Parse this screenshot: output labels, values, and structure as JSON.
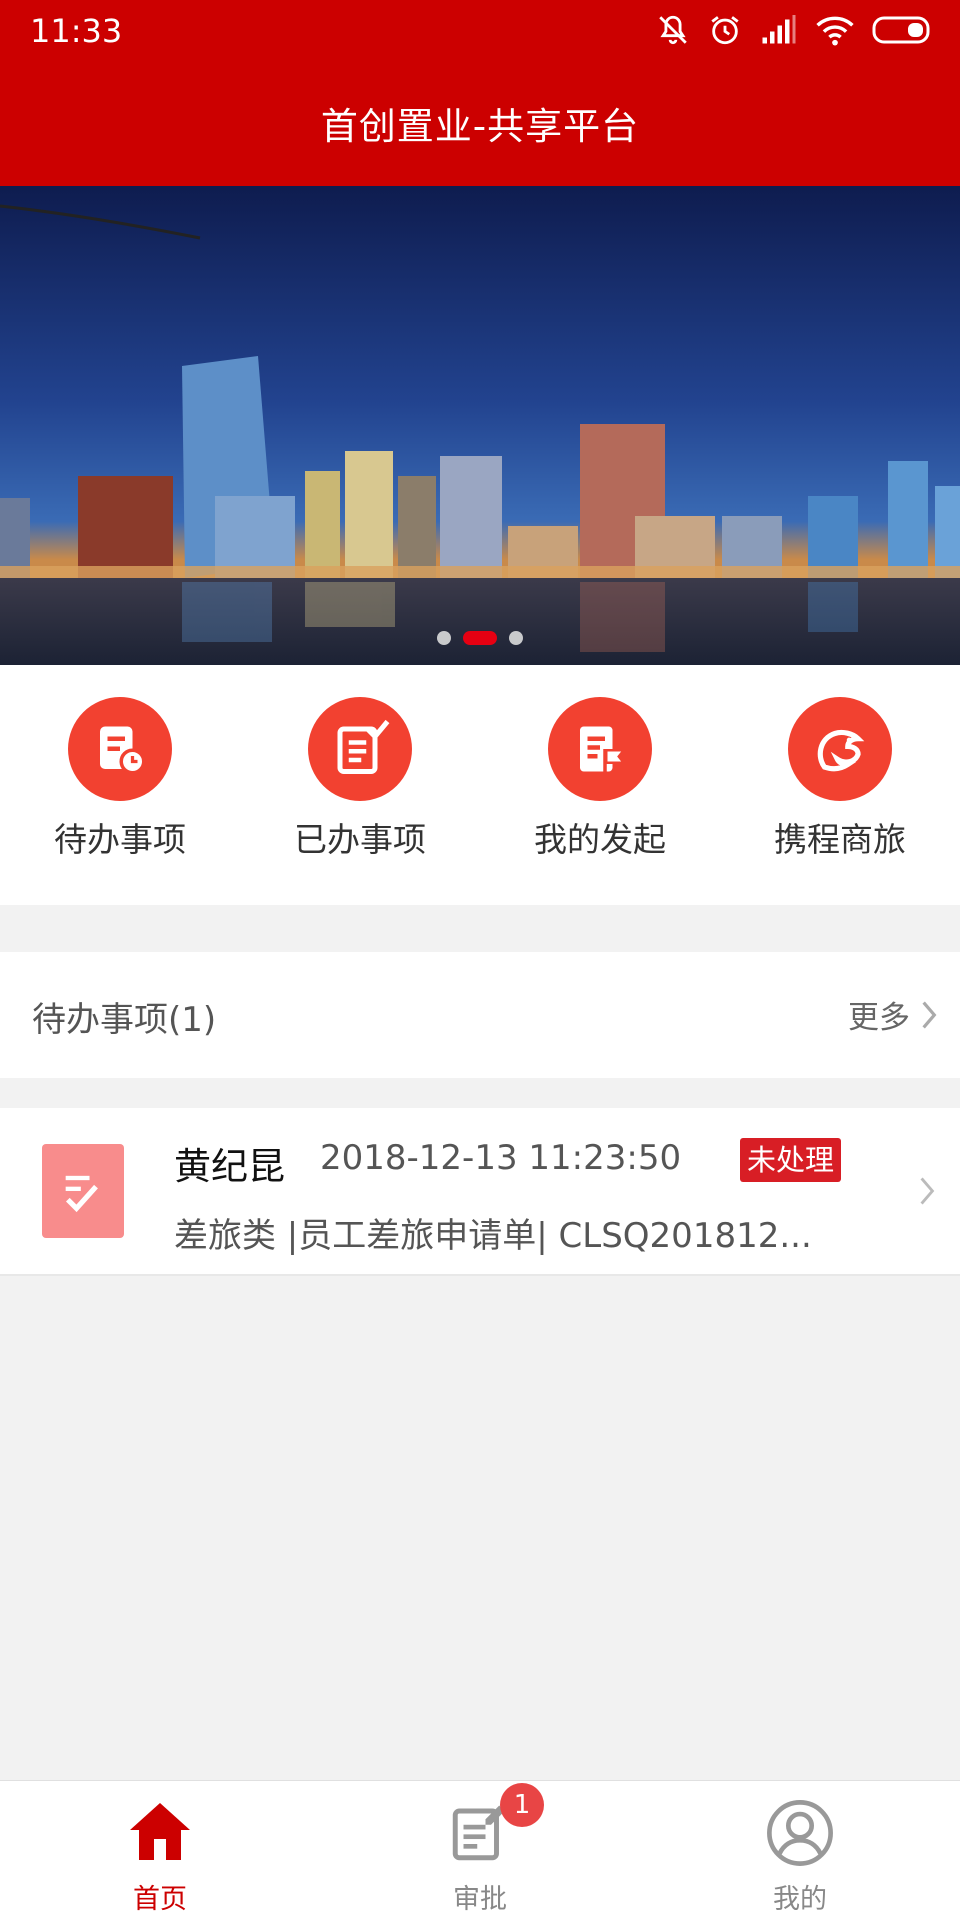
{
  "status_bar": {
    "time": "11:33",
    "icons": [
      "mute-icon",
      "alarm-icon",
      "signal-icon",
      "wifi-icon",
      "battery-icon"
    ]
  },
  "header": {
    "title": "首创置业-共享平台"
  },
  "banner": {
    "slide_count": 3,
    "active_slide": 2
  },
  "quick_menu": [
    {
      "label": "待办事项",
      "icon": "todo-doc-icon"
    },
    {
      "label": "已办事项",
      "icon": "done-edit-icon"
    },
    {
      "label": "我的发起",
      "icon": "initiated-flag-icon"
    },
    {
      "label": "携程商旅",
      "icon": "ctrip-dolphin-icon"
    }
  ],
  "todo_section": {
    "title": "待办事项(1)",
    "more_label": "更多"
  },
  "todo_item": {
    "name": "黄纪昆",
    "time": "2018-12-13 11:23:50",
    "status": "未处理",
    "description": "差旅类 |员工差旅申请单| CLSQ201812..."
  },
  "bottom_nav": [
    {
      "label": "首页",
      "icon": "home-icon",
      "active": true
    },
    {
      "label": "审批",
      "icon": "approval-icon",
      "badge": "1"
    },
    {
      "label": "我的",
      "icon": "profile-icon"
    }
  ],
  "colors": {
    "brand_red": "#cc0000",
    "icon_red": "#f24130",
    "badge_red": "#d81e25",
    "doc_icon_pink": "#f88c8c",
    "background": "#f2f2f2"
  }
}
